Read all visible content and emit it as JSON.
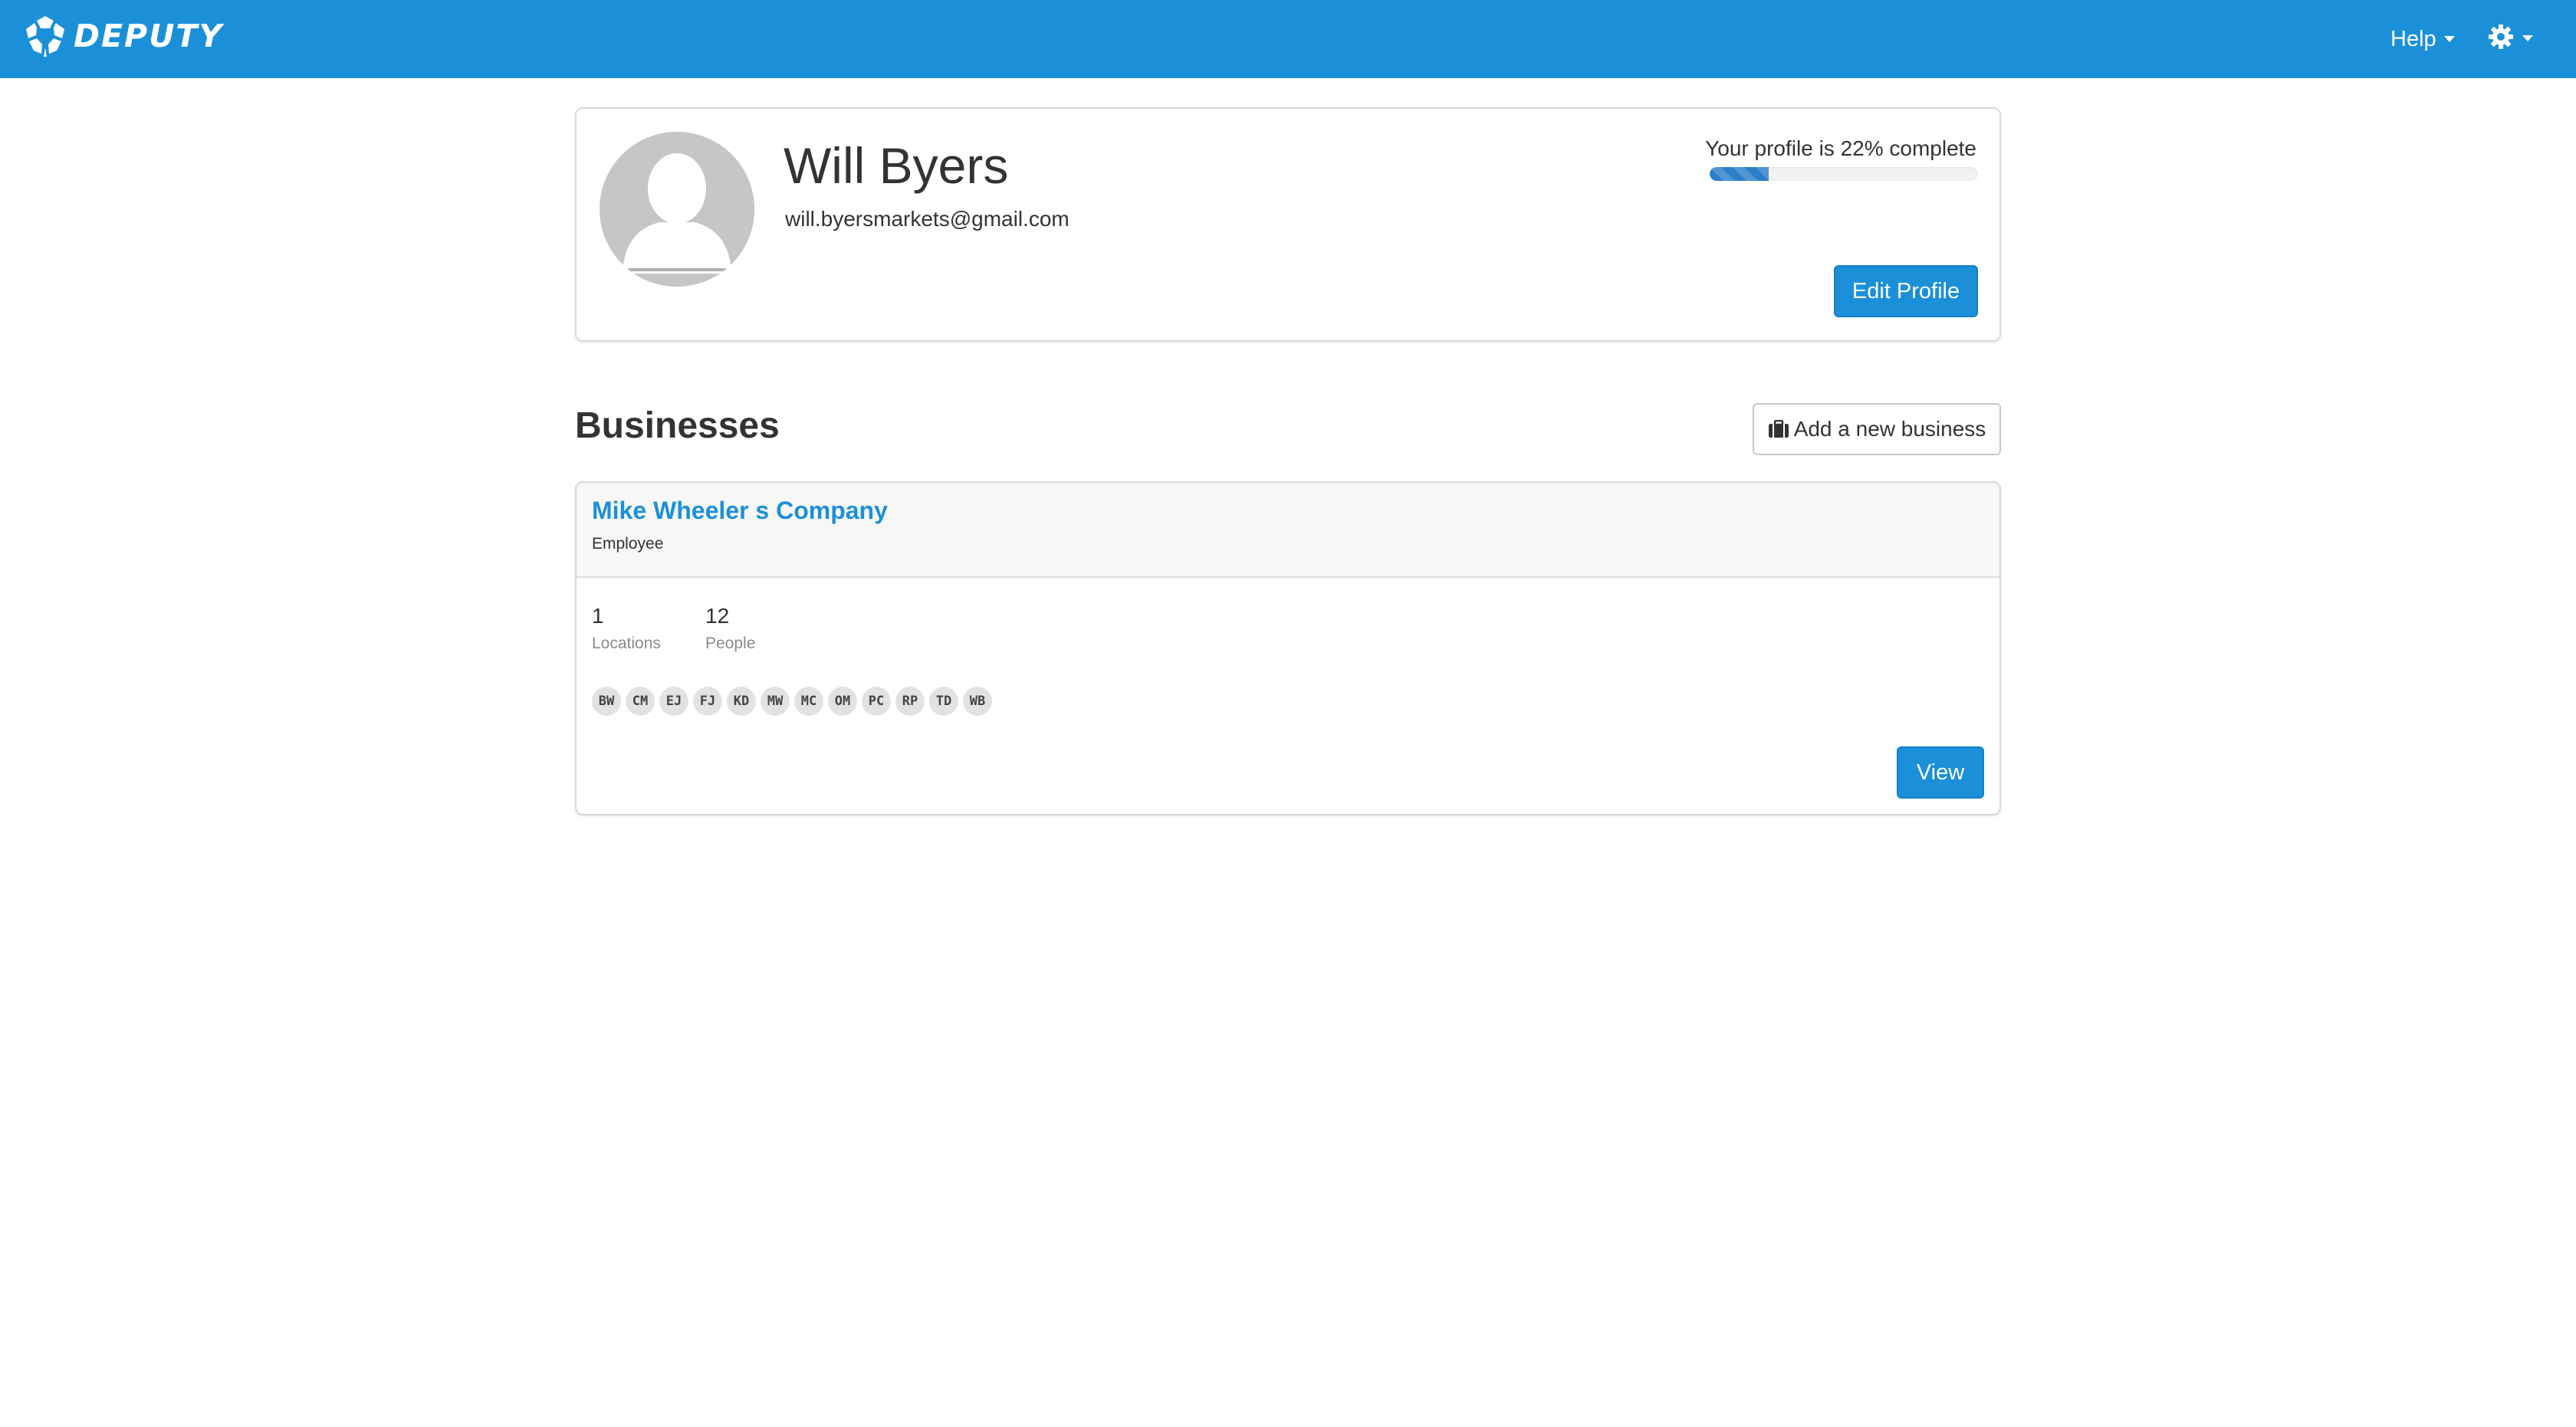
{
  "topbar": {
    "brand": "DEPUTY",
    "logo_icon": "deputy-badge-icon",
    "help_label": "Help",
    "settings_icon": "gear-icon",
    "background": "#1b90d9"
  },
  "profile": {
    "name": "Will Byers",
    "email": "will.byersmarkets@gmail.com",
    "avatar_icon": "user-silhouette-icon",
    "completion_label": "Your profile is 22% complete",
    "completion_percent": 22,
    "edit_label": "Edit Profile"
  },
  "businesses": {
    "title": "Businesses",
    "add_label": "Add a new business",
    "add_icon": "briefcase-icon",
    "items": [
      {
        "name": "Mike Wheeler s Company",
        "role": "Employee",
        "locations_value": "1",
        "locations_label": "Locations",
        "people_value": "12",
        "people_label": "People",
        "initials": [
          "BW",
          "CM",
          "EJ",
          "FJ",
          "KD",
          "MW",
          "MC",
          "OM",
          "PC",
          "RP",
          "TD",
          "WB"
        ],
        "view_label": "View"
      }
    ]
  },
  "colors": {
    "accent": "#1b90d9",
    "progress": "#2b7fc9",
    "badge_bg": "#e2e2e2"
  }
}
